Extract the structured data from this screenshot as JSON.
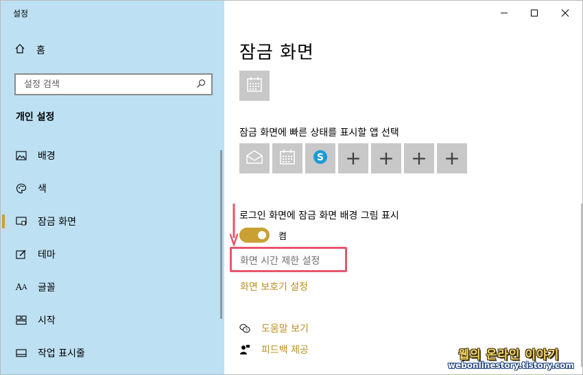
{
  "window": {
    "title": "설정"
  },
  "sidebar": {
    "home_label": "홈",
    "search_placeholder": "설정 검색",
    "section_title": "개인 설정",
    "items": [
      {
        "label": "배경",
        "icon": "picture-icon",
        "active": false
      },
      {
        "label": "색",
        "icon": "palette-icon",
        "active": false
      },
      {
        "label": "잠금 화면",
        "icon": "lock-screen-icon",
        "active": true
      },
      {
        "label": "테마",
        "icon": "theme-icon",
        "active": false
      },
      {
        "label": "글꼴",
        "icon": "font-icon",
        "active": false
      },
      {
        "label": "시작",
        "icon": "start-icon",
        "active": false
      },
      {
        "label": "작업 표시줄",
        "icon": "taskbar-icon",
        "active": false
      }
    ]
  },
  "content": {
    "page_title": "잠금 화면",
    "quick_status_label": "잠금 화면에 빠른 상태를 표시할 앱 선택",
    "quick_status_tiles": [
      "mail-icon",
      "calendar-icon",
      "skype-icon",
      "plus-icon",
      "plus-icon",
      "plus-icon",
      "plus-icon"
    ],
    "signin_bg_label": "로그인 화면에 잠금 화면 배경 그림 표시",
    "toggle_state": "켬",
    "screen_timeout_link": "화면 시간 제한 설정",
    "screensaver_link": "화면 보호기 설정",
    "help_link": "도움말 보기",
    "feedback_link": "피드백 제공"
  },
  "colors": {
    "sidebar_bg": "#bde0f3",
    "accent": "#c8a033",
    "link": "#b88f1f",
    "highlight": "#e8556c"
  },
  "watermark": {
    "line1": "웹의 온라인 이야기",
    "line2": "webonlinestory.tistory.com"
  }
}
